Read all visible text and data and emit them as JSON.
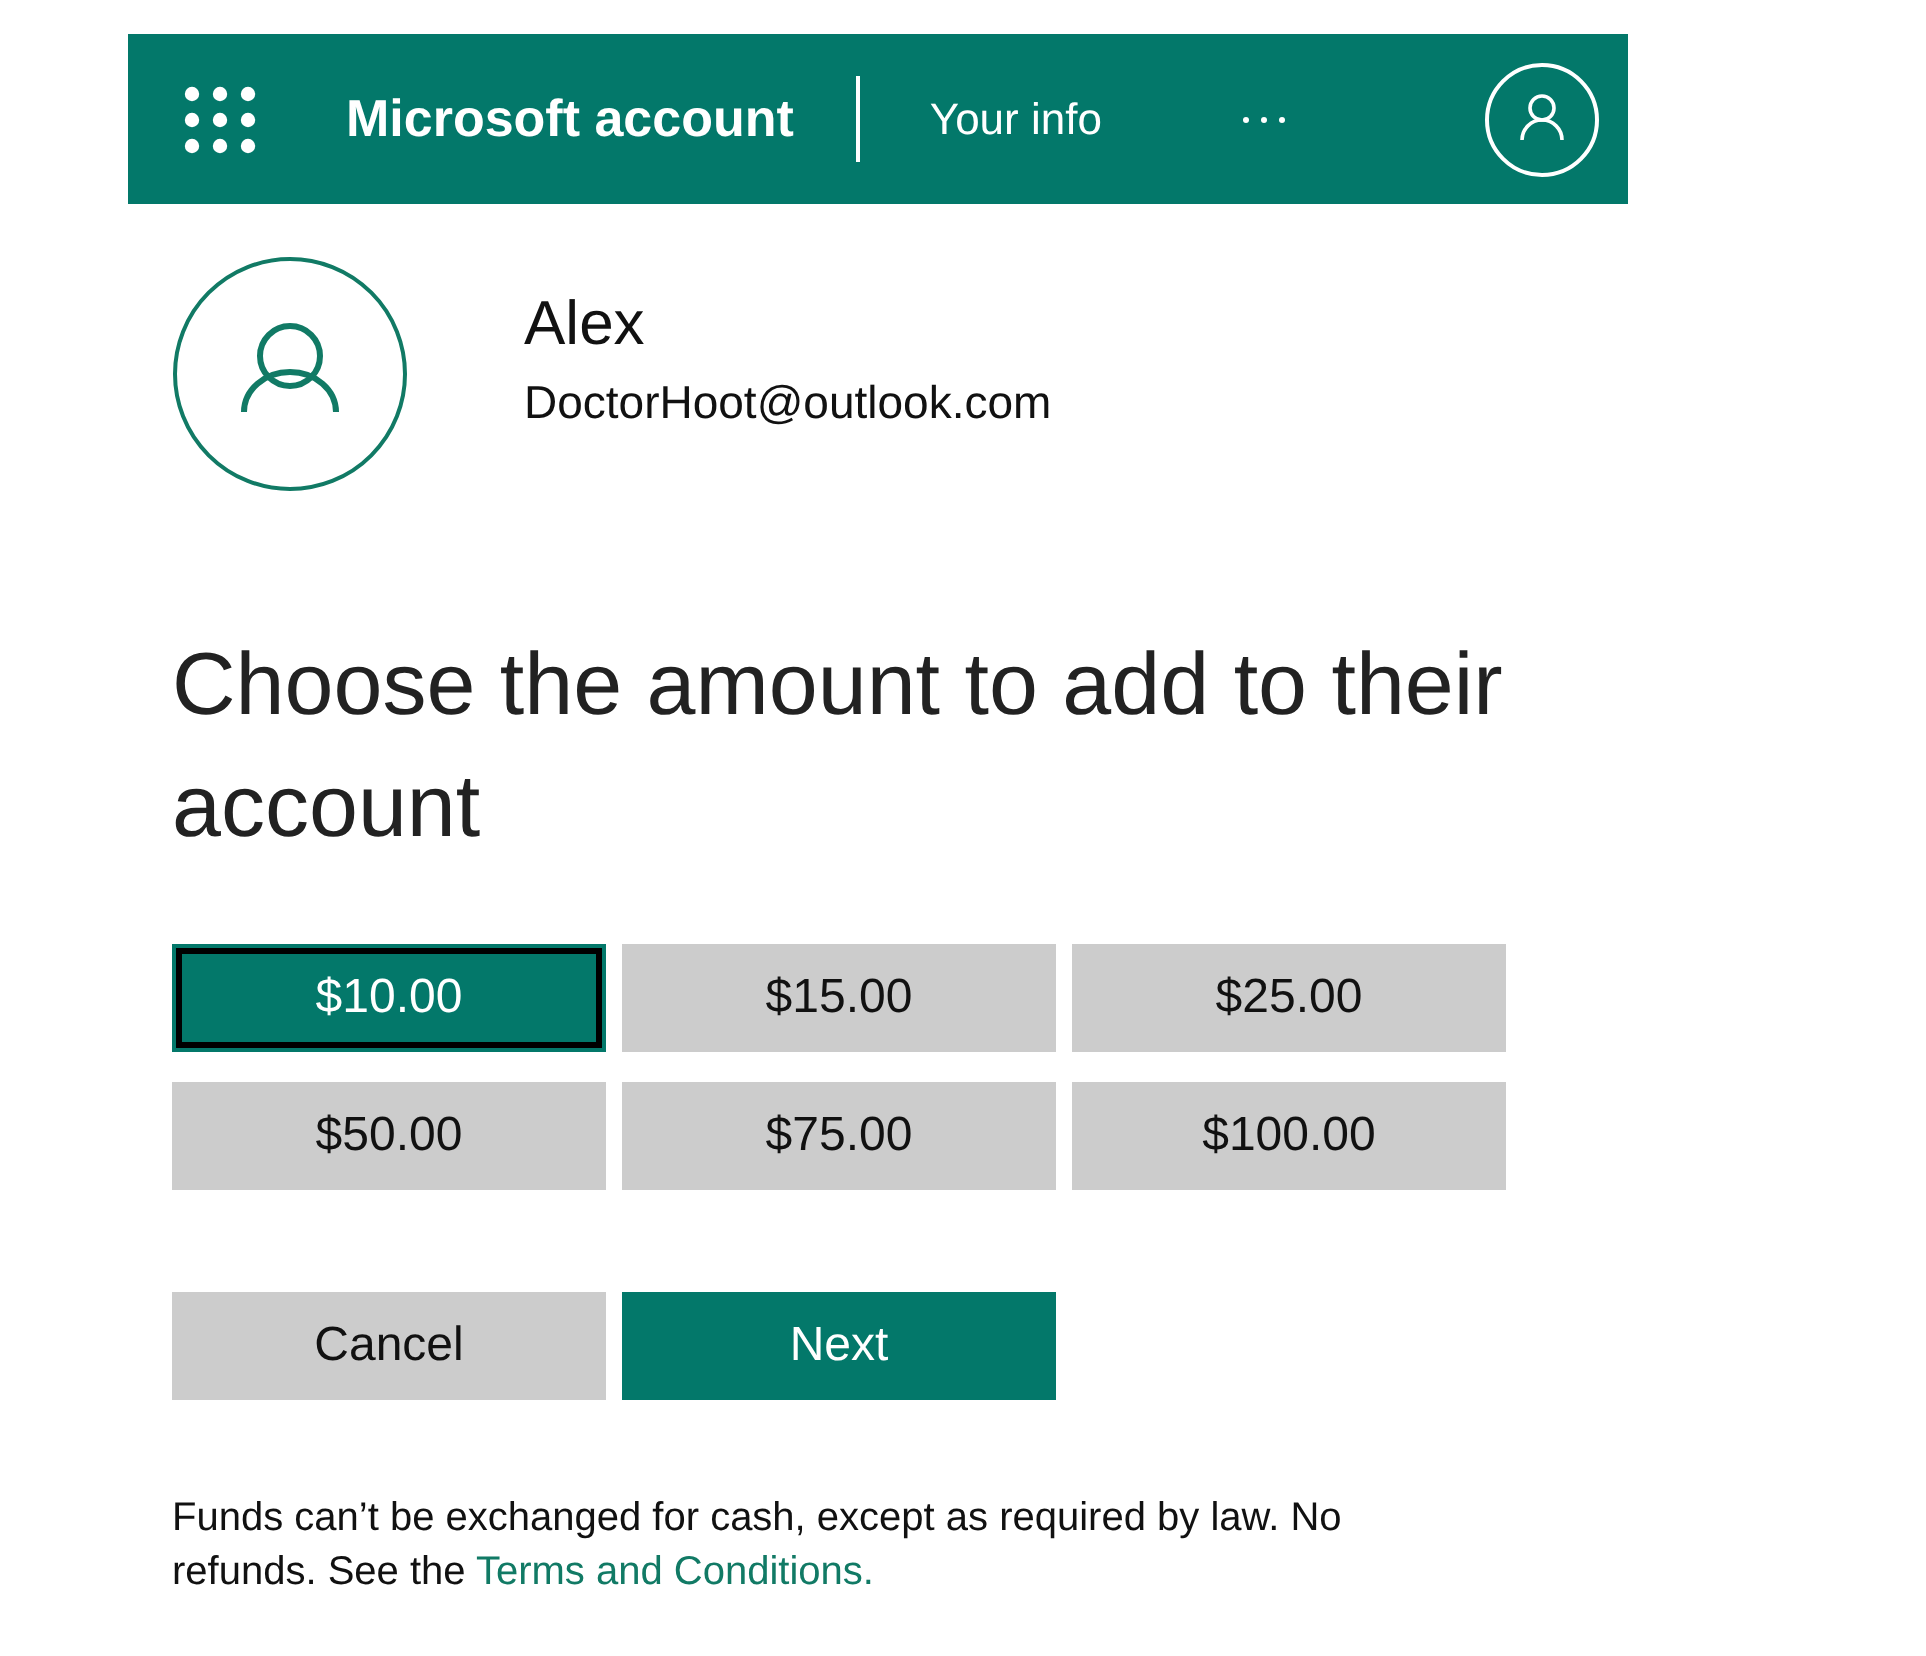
{
  "header": {
    "app_title": "Microsoft account",
    "section": "Your info"
  },
  "profile": {
    "name": "Alex",
    "email": "DoctorHoot@outlook.com"
  },
  "heading": "Choose the amount to add to their account",
  "amounts": [
    {
      "label": "$10.00",
      "selected": true
    },
    {
      "label": "$15.00",
      "selected": false
    },
    {
      "label": "$25.00",
      "selected": false
    },
    {
      "label": "$50.00",
      "selected": false
    },
    {
      "label": "$75.00",
      "selected": false
    },
    {
      "label": "$100.00",
      "selected": false
    }
  ],
  "actions": [
    {
      "label": "Cancel",
      "kind": "secondary"
    },
    {
      "label": "Next",
      "kind": "primary"
    }
  ],
  "disclaimer": {
    "text": "Funds can’t be exchanged for cash, except as required by law. No refunds. See the",
    "link": "Terms and Conditions."
  }
}
